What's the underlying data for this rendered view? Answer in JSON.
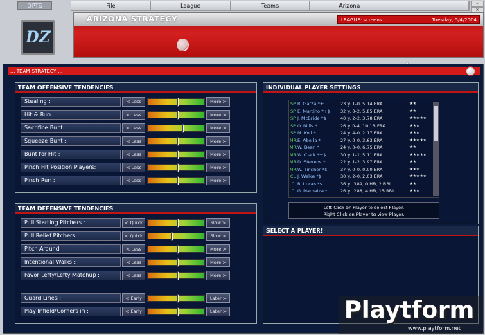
{
  "logo_tab": "OPTS",
  "team_logo_text": "DZ",
  "menu": [
    "File",
    "League",
    "Teams",
    "Arizona"
  ],
  "window_controls": [
    "–",
    "×"
  ],
  "header": {
    "title": "ARIZONA STRATEGY",
    "league_label": "LEAGUE: screens",
    "date": "Tuesday, 5/4/2004"
  },
  "section_title": "... TEAM STRATEGY ...",
  "offensive": {
    "title": "TEAM OFFENSIVE TENDENCIES",
    "rows": [
      {
        "label": "Stealing :",
        "left": "< Less",
        "right": "More >",
        "level": 0.53
      },
      {
        "label": "Hit & Run :",
        "left": "< Less",
        "right": "More >",
        "level": 0.53
      },
      {
        "label": "Sacrifice Bunt :",
        "left": "< Less",
        "right": "More >",
        "level": 0.62
      },
      {
        "label": "Squeeze Bunt :",
        "left": "< Less",
        "right": "More >",
        "level": 0.53
      },
      {
        "label": "Bunt for Hit :",
        "left": "< Less",
        "right": "More >",
        "level": 0.53
      },
      {
        "label": "Pinch Hit Position Players:",
        "left": "< Less",
        "right": "More >",
        "level": 0.53
      },
      {
        "label": "Pinch Run :",
        "left": "< Less",
        "right": "More >",
        "level": 0.53
      }
    ]
  },
  "defensive": {
    "title": "TEAM DEFENSIVE TENDENCIES",
    "rows": [
      {
        "label": "Pull Starting Pitchers :",
        "left": "< Quick",
        "right": "Slow >",
        "level": 0.53
      },
      {
        "label": "Pull Relief Pitchers:",
        "left": "< Quick",
        "right": "Slow >",
        "level": 0.42
      },
      {
        "label": "Pitch Around :",
        "left": "< Less",
        "right": "More >",
        "level": 0.53
      },
      {
        "label": "Intentional Walks :",
        "left": "< Less",
        "right": "More >",
        "level": 0.53
      },
      {
        "label": "Favor Lefty/Lefty Matchup :",
        "left": "< Less",
        "right": "More >",
        "level": 0.53
      },
      {
        "label": "Guard Lines :",
        "left": "< Early",
        "right": "Later >",
        "level": 0.53
      },
      {
        "label": "Play Infield/Corners in :",
        "left": "< Early",
        "right": "Later >",
        "level": 0.53
      }
    ]
  },
  "players": {
    "title": "INDIVIDUAL PLAYER SETTINGS",
    "rows": [
      {
        "pos": "SP",
        "name": "R. Garza *+",
        "stats": "23 y.  1-0, 5.14 ERA",
        "stars": "★★"
      },
      {
        "pos": "SP",
        "name": "E. Martino *+$",
        "stats": "32 y.  0-2, 5.85 ERA",
        "stars": "★★"
      },
      {
        "pos": "SP",
        "name": "J. McBride *$",
        "stats": "40 y.  2-2, 3.78 ERA",
        "stars": "★★★★★"
      },
      {
        "pos": "SP",
        "name": "O. Mills *",
        "stats": "26 y.  0-4, 10.13 ERA",
        "stars": "★★★"
      },
      {
        "pos": "SP",
        "name": "M. Koll *",
        "stats": "24 y.  4-0, 2.17 ERA",
        "stars": "★★★"
      },
      {
        "pos": "MR",
        "name": "E. Abella *",
        "stats": "27 y.  0-0, 3.63 ERA",
        "stars": "★★★★★"
      },
      {
        "pos": "MR",
        "name": "W. Bean *",
        "stats": "24 y.  0-0, 6.75 ERA",
        "stars": "★★"
      },
      {
        "pos": "MR",
        "name": "W. Clark *+$",
        "stats": "30 y.  1-1, 5.11 ERA",
        "stars": "★★★★★"
      },
      {
        "pos": "MR",
        "name": "D. Stevens *",
        "stats": "22 y.  1-2, 3.97 ERA",
        "stars": "★★"
      },
      {
        "pos": "MR",
        "name": "W. Tincher *$",
        "stats": "37 y.  0-0, 0.00 ERA",
        "stars": "★★★"
      },
      {
        "pos": "CL",
        "name": "J. Welke *$",
        "stats": "30 y.  2-0, 2.03 ERA",
        "stars": "★★★★★"
      },
      {
        "pos": "C",
        "name": "B. Lucas *$",
        "stats": "36 y.  .389, 0 HR, 2 RBI",
        "stars": "★★"
      },
      {
        "pos": "C",
        "name": "G. Narbaiza *",
        "stats": "26 y.  .288, 4 HR, 15 RBI",
        "stars": "★★★"
      }
    ],
    "hint_line1": "Left-Click on Player to select Player.",
    "hint_line2": "Right-Click on Player to view Player."
  },
  "select_panel_title": "SELECT A PLAYER!",
  "watermark": {
    "text": "Playtform",
    "url": "www.playtform.net"
  }
}
